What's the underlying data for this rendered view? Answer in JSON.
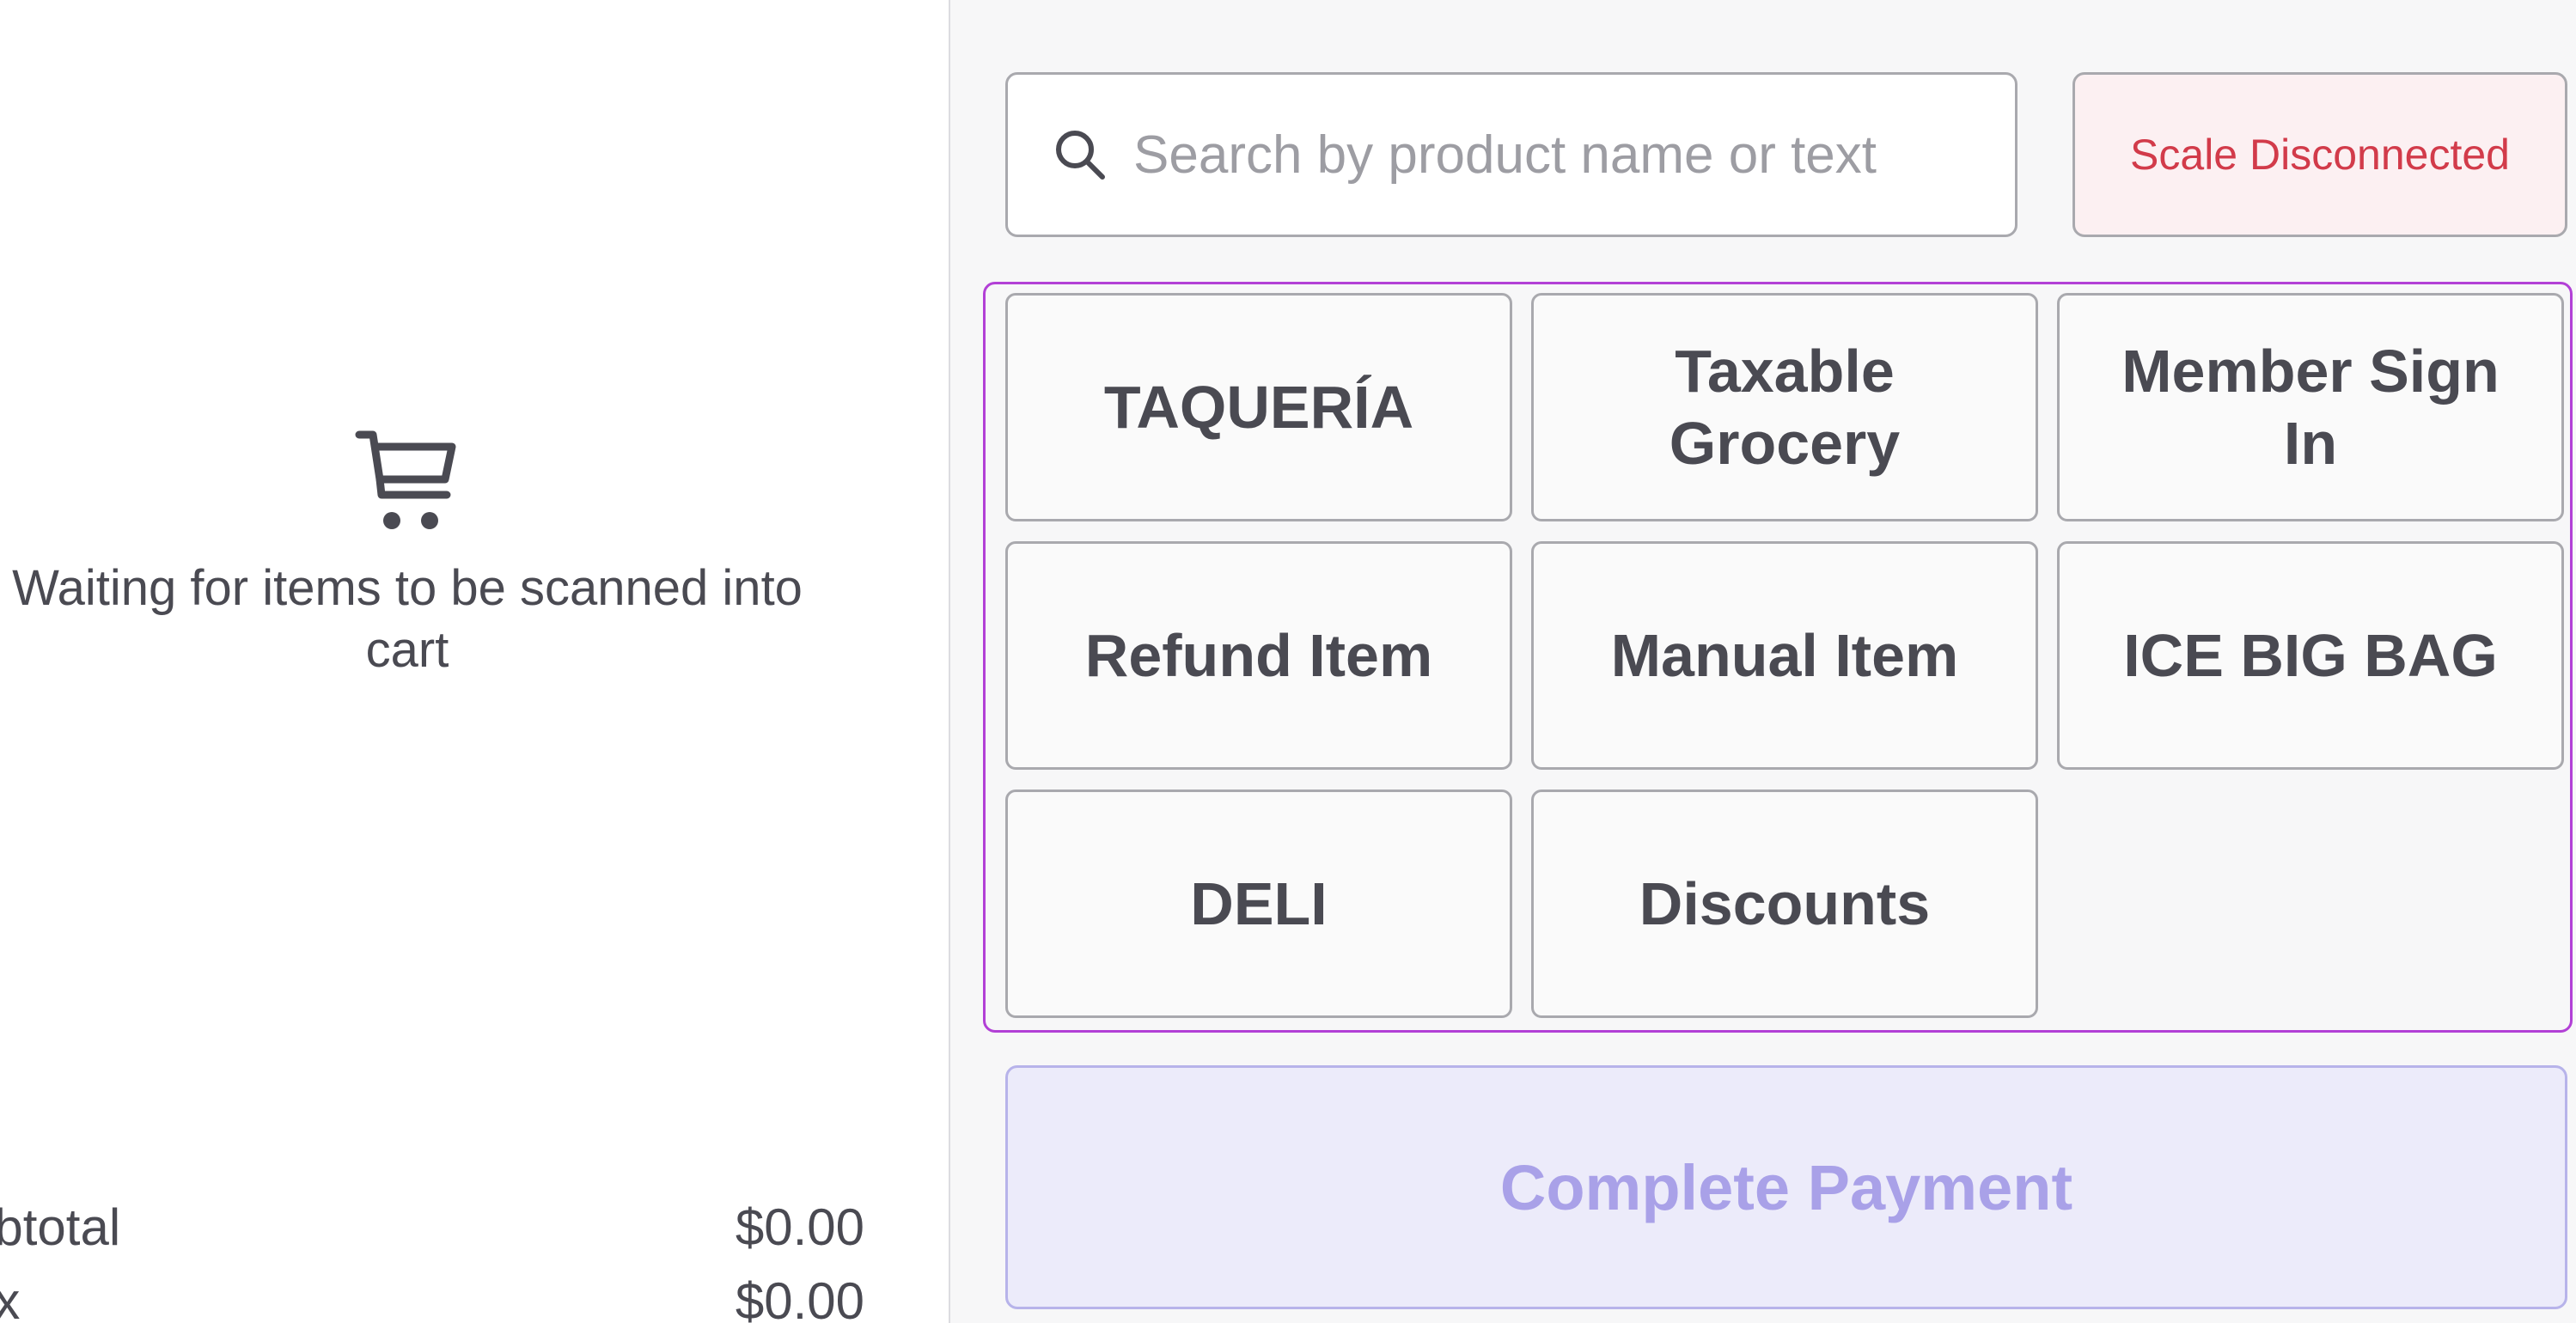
{
  "cart": {
    "icon": "shopping-cart-icon",
    "empty_message": "Waiting for items to be scanned into cart",
    "subtotal_label": "ubtotal",
    "subtotal_value": "$0.00",
    "tax_label": "ax",
    "tax_value": "$0.00"
  },
  "search": {
    "icon": "search-icon",
    "placeholder": "Search by product name or text",
    "value": ""
  },
  "scale": {
    "status": "Scale Disconnected"
  },
  "quick_keys": [
    {
      "label": "TAQUERÍA"
    },
    {
      "label": "Taxable Grocery"
    },
    {
      "label": "Member Sign In"
    },
    {
      "label": "Refund Item"
    },
    {
      "label": "Manual Item"
    },
    {
      "label": "ICE BIG BAG"
    },
    {
      "label": "DELI"
    },
    {
      "label": "Discounts"
    }
  ],
  "payment": {
    "complete_label": "Complete Payment"
  },
  "colors": {
    "accent_border": "#b240d6",
    "scale_error_text": "#d23b4a",
    "scale_error_bg": "#fcf0f2",
    "payment_bg": "#ecebfa",
    "payment_text": "#a9a1e8"
  }
}
